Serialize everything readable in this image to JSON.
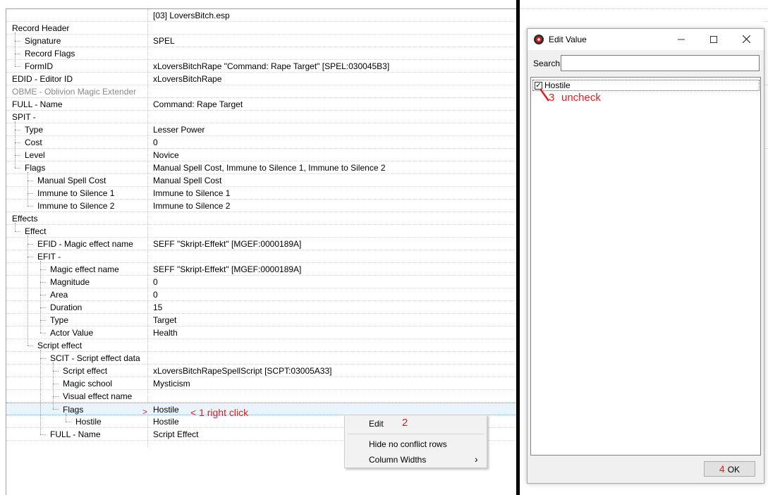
{
  "tree": {
    "header_value": "[03] LoversBitch.esp",
    "rows": [
      {
        "name": "Record Header",
        "value": ""
      },
      {
        "name": "Signature",
        "value": "SPEL"
      },
      {
        "name": "Record Flags",
        "value": ""
      },
      {
        "name": "FormID",
        "value": "xLoversBitchRape \"Command: Rape Target\" [SPEL:030045B3]"
      },
      {
        "name": "EDID - Editor ID",
        "value": "xLoversBitchRape"
      },
      {
        "name": "OBME - Oblivion Magic Extender",
        "value": ""
      },
      {
        "name": "FULL - Name",
        "value": "Command: Rape Target"
      },
      {
        "name": "SPIT -",
        "value": ""
      },
      {
        "name": "Type",
        "value": "Lesser Power"
      },
      {
        "name": "Cost",
        "value": "0"
      },
      {
        "name": "Level",
        "value": "Novice"
      },
      {
        "name": "Flags",
        "value": "Manual Spell Cost, Immune to Silence 1, Immune to Silence 2"
      },
      {
        "name": "Manual Spell Cost",
        "value": "Manual Spell Cost"
      },
      {
        "name": "Immune to Silence 1",
        "value": "Immune to Silence 1"
      },
      {
        "name": "Immune to Silence 2",
        "value": "Immune to Silence 2"
      },
      {
        "name": "Effects",
        "value": ""
      },
      {
        "name": "Effect",
        "value": ""
      },
      {
        "name": "EFID - Magic effect name",
        "value": "SEFF \"Skript-Effekt\" [MGEF:0000189A]"
      },
      {
        "name": "EFIT -",
        "value": ""
      },
      {
        "name": "Magic effect name",
        "value": "SEFF \"Skript-Effekt\" [MGEF:0000189A]"
      },
      {
        "name": "Magnitude",
        "value": "0"
      },
      {
        "name": "Area",
        "value": "0"
      },
      {
        "name": "Duration",
        "value": "15"
      },
      {
        "name": "Type",
        "value": "Target"
      },
      {
        "name": "Actor Value",
        "value": "Health"
      },
      {
        "name": "Script effect",
        "value": ""
      },
      {
        "name": "SCIT - Script effect data",
        "value": ""
      },
      {
        "name": "Script effect",
        "value": "xLoversBitchRapeSpellScript [SCPT:03005A33]"
      },
      {
        "name": "Magic school",
        "value": "Mysticism"
      },
      {
        "name": "Visual effect name",
        "value": ""
      },
      {
        "name": "Flags",
        "value": "Hostile"
      },
      {
        "name": "Hostile",
        "value": "Hostile"
      },
      {
        "name": "FULL - Name",
        "value": "Script Effect"
      }
    ]
  },
  "annotations": {
    "arrow": ">",
    "step1": "< 1   right click",
    "step2": "2",
    "step3_num": "3",
    "step3_text": "uncheck",
    "step4": "4"
  },
  "context_menu": {
    "edit": "Edit",
    "hide_no_conflict": "Hide no conflict rows",
    "column_widths": "Column Widths",
    "submenu_arrow": "›"
  },
  "dialog": {
    "title": "Edit Value",
    "search_label": "Search",
    "search_value": "",
    "items": [
      {
        "label": "Hostile",
        "checked": true
      }
    ],
    "ok_label": "OK"
  },
  "colors": {
    "annotation_red": "#e02020",
    "selected_row": "#eaf4fc"
  }
}
